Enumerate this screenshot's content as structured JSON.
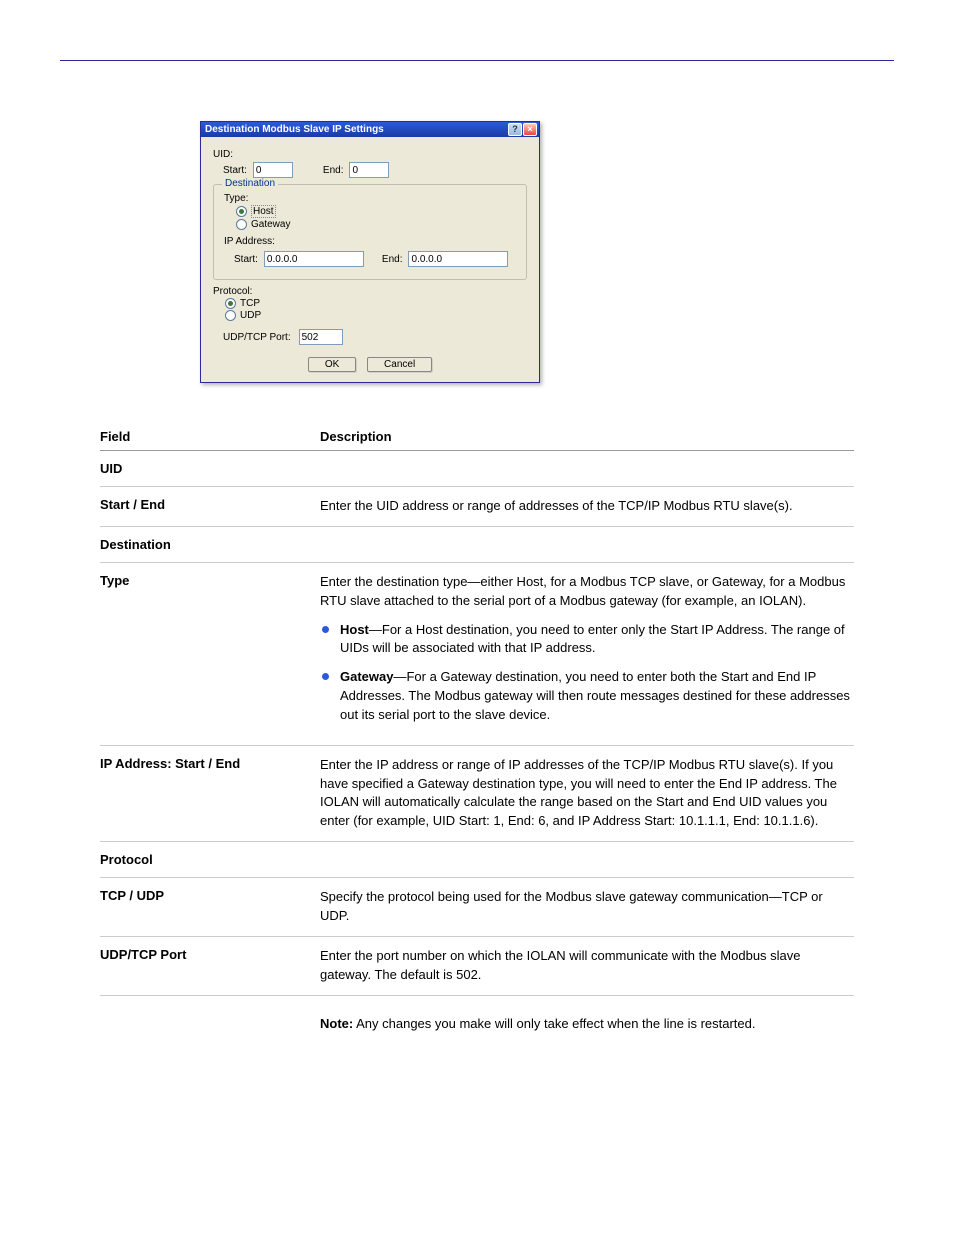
{
  "page": {
    "section_header_left": "",
    "section_header_right": "",
    "footer_left": "",
    "footer_right": ""
  },
  "dialog": {
    "title": "Destination Modbus Slave IP Settings",
    "uid": {
      "label": "UID:",
      "start_label": "Start:",
      "start_value": "0",
      "end_label": "End:",
      "end_value": "0"
    },
    "destination": {
      "legend": "Destination",
      "type_label": "Type:",
      "host_label": "Host",
      "gateway_label": "Gateway",
      "ip_label": "IP Address:",
      "ip_start_label": "Start:",
      "ip_start_value": "0.0.0.0",
      "ip_end_label": "End:",
      "ip_end_value": "0.0.0.0"
    },
    "protocol": {
      "label": "Protocol:",
      "tcp_label": "TCP",
      "udp_label": "UDP",
      "port_label": "UDP/TCP Port:",
      "port_value": "502"
    },
    "buttons": {
      "ok": "OK",
      "cancel": "Cancel"
    }
  },
  "doc": {
    "headers": {
      "field": "Field",
      "desc": "Description"
    },
    "section1": {
      "field": "UID"
    },
    "section1_sub": {
      "field": "Start / End",
      "desc": "Enter the UID address or range of addresses of the TCP/IP Modbus RTU slave(s)."
    },
    "section2": {
      "field": "Destination"
    },
    "section2_type": {
      "field": "Type",
      "para1": "Enter the destination type—either Host, for a Modbus TCP slave, or Gateway, for a Modbus RTU slave attached to the serial port of a Modbus gateway (for example, an IOLAN).",
      "b1_lead": "Host",
      "b1_text": "—For a Host destination, you need to enter only the Start IP Address. The range of UIDs will be associated with that IP address.",
      "b2_lead": "Gateway",
      "b2_text": "—For a Gateway destination, you need to enter both the Start and End IP Addresses. The Modbus gateway will then route messages destined for these addresses out its serial port to the slave device."
    },
    "section2_ip": {
      "field": "IP Address: Start / End",
      "desc": "Enter the IP address or range of IP addresses of the TCP/IP Modbus RTU slave(s). If you have specified a Gateway destination type, you will need to enter the End IP address. The IOLAN will automatically calculate the range based on the Start and End UID values you enter (for example, UID Start: 1, End: 6, and IP Address Start: 10.1.1.1, End: 10.1.1.6)."
    },
    "section3": {
      "field": "Protocol"
    },
    "section3_tcpudp": {
      "field": "TCP / UDP",
      "desc": "Specify the protocol being used for the Modbus slave gateway communication—TCP or UDP."
    },
    "section3_port": {
      "field": "UDP/TCP Port",
      "desc_lead": "Enter the port number on which the IOLAN will communicate with the Modbus slave gateway.",
      "desc_default": " The default is 502."
    },
    "note_label": "Note:",
    "note_text": " Any changes you make will only take effect when the line is restarted."
  }
}
